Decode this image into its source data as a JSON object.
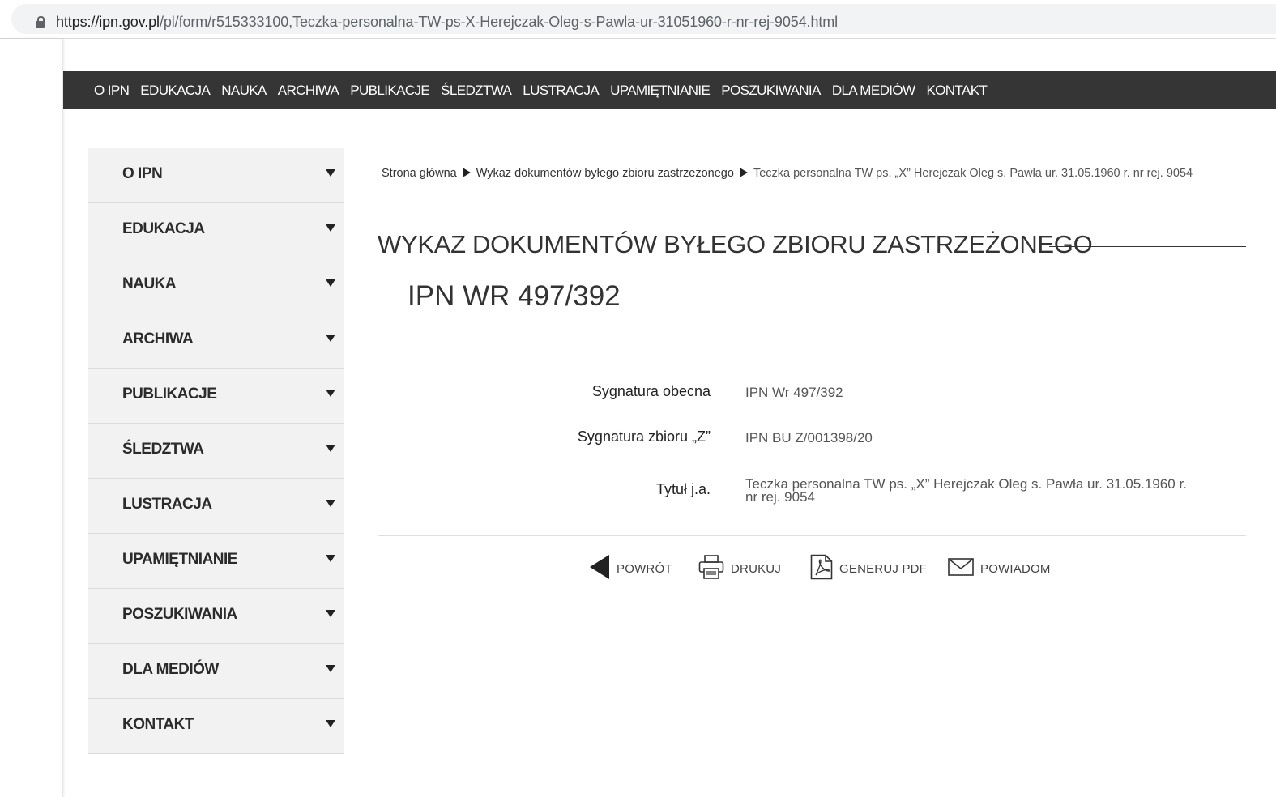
{
  "browser": {
    "url_host": "https://ipn.gov.pl",
    "url_path": "/pl/form/r515333100,Teczka-personalna-TW-ps-X-Herejczak-Oleg-s-Pawla-ur-31051960-r-nr-rej-9054.html"
  },
  "topnav": {
    "items": [
      "O IPN",
      "EDUKACJA",
      "NAUKA",
      "ARCHIWA",
      "PUBLIKACJE",
      "ŚLEDZTWA",
      "LUSTRACJA",
      "UPAMIĘTNIANIE",
      "POSZUKIWANIA",
      "DLA MEDIÓW",
      "KONTAKT"
    ]
  },
  "sidebar": {
    "items": [
      "O IPN",
      "EDUKACJA",
      "NAUKA",
      "ARCHIWA",
      "PUBLIKACJE",
      "ŚLEDZTWA",
      "LUSTRACJA",
      "UPAMIĘTNIANIE",
      "POSZUKIWANIA",
      "DLA MEDIÓW",
      "KONTAKT"
    ]
  },
  "breadcrumb": {
    "items": [
      "Strona główna",
      "Wykaz dokumentów byłego zbioru zastrzeżonego",
      "Teczka personalna TW ps. „X” Herejczak Oleg s. Pawła ur. 31.05.1960 r. nr rej. 9054"
    ]
  },
  "main": {
    "section_title": "WYKAZ DOKUMENTÓW BYŁEGO ZBIORU ZASTRZEŻONEGO",
    "doc_id": "IPN WR 497/392",
    "fields": [
      {
        "label": "Sygnatura obecna",
        "value": "IPN Wr 497/392"
      },
      {
        "label": "Sygnatura zbioru „Z”",
        "value": "IPN BU Z/001398/20"
      },
      {
        "label": "Tytuł j.a.",
        "value": "Teczka personalna TW ps. „X” Herejczak Oleg s. Pawła ur. 31.05.1960 r. nr rej. 9054"
      }
    ]
  },
  "actions": {
    "back": "POWRÓT",
    "print": "DRUKUJ",
    "pdf": "GENERUJ PDF",
    "notify": "POWIADOM"
  }
}
